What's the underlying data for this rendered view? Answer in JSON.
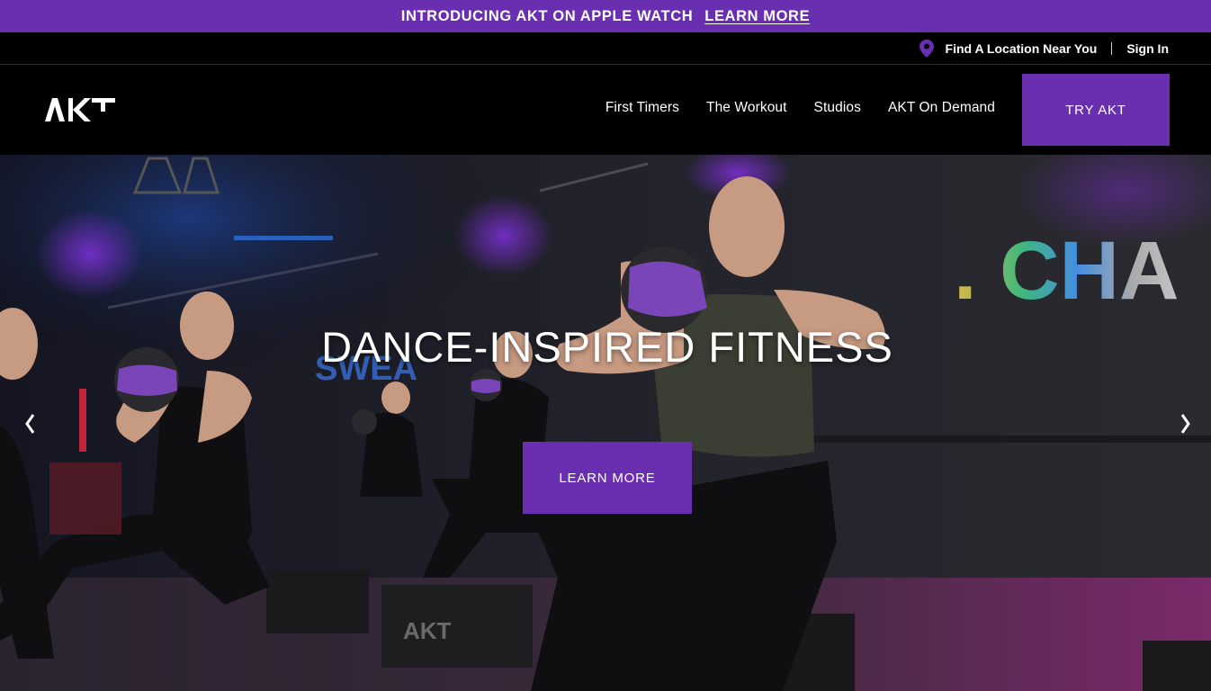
{
  "announcement": {
    "text": "INTRODUCING AKT ON APPLE WATCH",
    "link": "LEARN MORE"
  },
  "utility": {
    "location": "Find A Location Near You",
    "signin": "Sign In"
  },
  "nav": {
    "logo_text": "AKT",
    "links": [
      "First Timers",
      "The Workout",
      "Studios",
      "AKT On Demand"
    ],
    "cta": "TRY AKT"
  },
  "hero": {
    "headline": "DANCE-INSPIRED FITNESS",
    "cta": "LEARN MORE",
    "wall_text": ". CHA",
    "wall_text_2": "SWEA",
    "box_logo": "AKT"
  },
  "colors": {
    "accent": "#6a2fb0",
    "background": "#000000"
  },
  "icons": [
    "location-pin-icon",
    "akt-logo",
    "chevron-left-icon",
    "chevron-right-icon"
  ]
}
